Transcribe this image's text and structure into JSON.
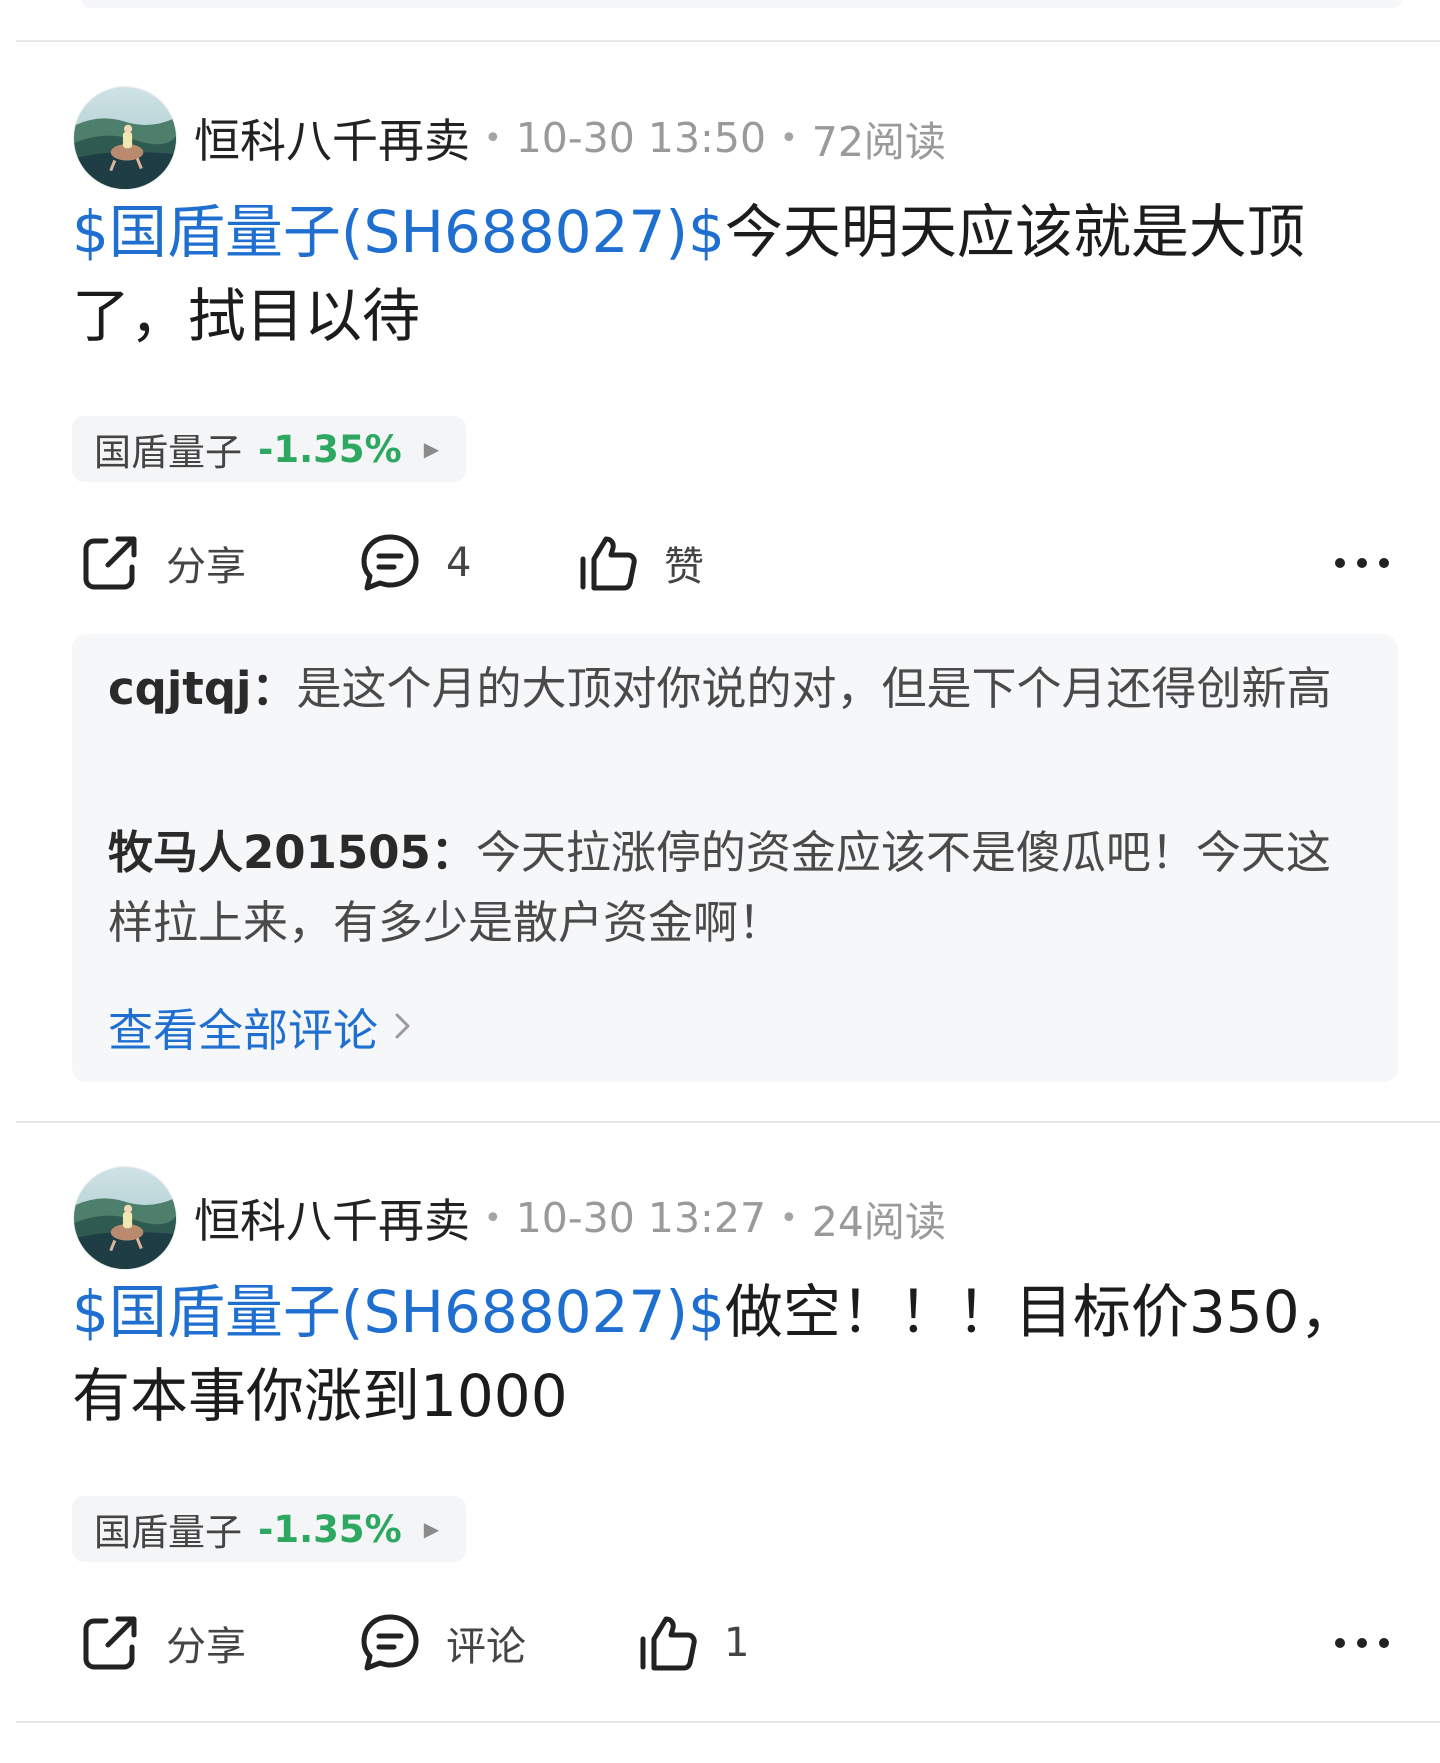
{
  "posts": [
    {
      "author": "恒科八千再卖",
      "time": "10-30 13:50",
      "reads": "72阅读",
      "stock_link": "$国盾量子(SH688027)$",
      "text": "今天明天应该就是大顶了，拭目以待",
      "tag": {
        "name": "国盾量子",
        "change": "-1.35%"
      },
      "actions": {
        "share": "分享",
        "comment": "4",
        "like": "赞"
      },
      "comments": [
        {
          "user": "cqjtqj：",
          "text": "是这个月的大顶对你说的对，但是下个月还得创新高"
        },
        {
          "user": "牧马人201505：",
          "text": "今天拉涨停的资金应该不是傻瓜吧！今天这样拉上来，有多少是散户资金啊！"
        }
      ],
      "view_all": "查看全部评论"
    },
    {
      "author": "恒科八千再卖",
      "time": "10-30 13:27",
      "reads": "24阅读",
      "stock_link": "$国盾量子(SH688027)$",
      "text": "做空！！！目标价350，有本事你涨到1000",
      "tag": {
        "name": "国盾量子",
        "change": "-1.35%"
      },
      "actions": {
        "share": "分享",
        "comment": "评论",
        "like": "1"
      }
    }
  ],
  "colors": {
    "link": "#1f6fd1",
    "down": "#2ea860",
    "muted": "#9a9a9a"
  },
  "icons": {
    "share": "share-icon",
    "comment": "comment-icon",
    "like": "thumbs-up-icon",
    "more": "more-icon",
    "play": "play-icon",
    "chevron": "chevron-right-icon"
  }
}
